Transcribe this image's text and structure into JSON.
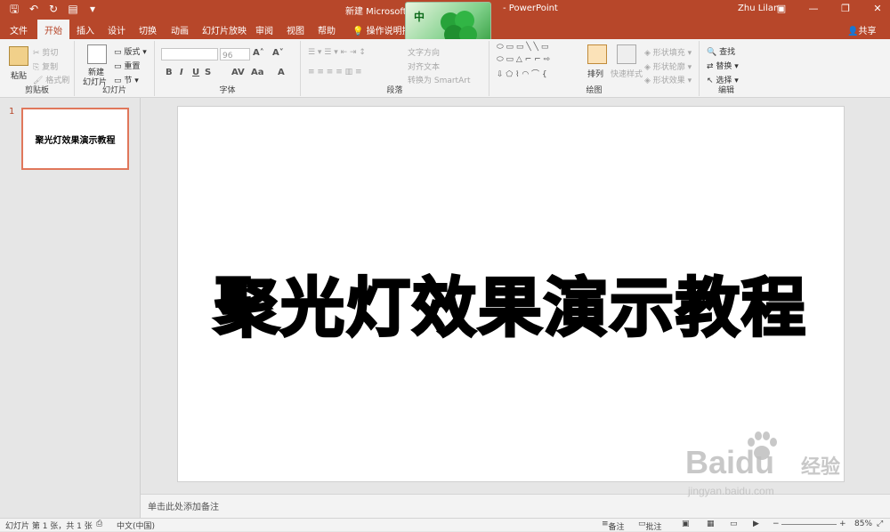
{
  "titlebar": {
    "title": "新建 Microsoft P",
    "title_suffix": "- PowerPoint",
    "user": "Zhu Lilan",
    "ime_char": "中"
  },
  "tabs": [
    "文件",
    "开始",
    "插入",
    "设计",
    "切换",
    "动画",
    "幻灯片放映",
    "审阅",
    "视图",
    "帮助"
  ],
  "active_tab": "开始",
  "tellme": "操作说明搜索",
  "share": "共享",
  "ribbon": {
    "clipboard": {
      "paste": "粘贴",
      "cut": "剪切",
      "copy": "复制",
      "painter": "格式刷",
      "label": "剪贴板"
    },
    "slides": {
      "new": "新建",
      "new2": "幻灯片",
      "layout": "版式",
      "reset": "重置",
      "section": "节",
      "label": "幻灯片"
    },
    "font": {
      "size": "96",
      "label": "字体",
      "bold": "B",
      "italic": "I",
      "underline": "U",
      "shadow": "S",
      "spacing": "AV",
      "case": "Aa",
      "color": "A"
    },
    "paragraph": {
      "textdir": "文字方向",
      "align": "对齐文本",
      "smartart": "转换为 SmartArt",
      "label": "段落"
    },
    "drawing": {
      "arrange": "排列",
      "quickstyle": "快速样式",
      "fill": "形状填充",
      "outline": "形状轮廓",
      "effect": "形状效果",
      "label": "绘图"
    },
    "editing": {
      "find": "查找",
      "replace": "替换",
      "select": "选择",
      "label": "编辑"
    }
  },
  "slide_panel": {
    "number": "1",
    "thumb_text": "聚光灯效果演示教程"
  },
  "slide": {
    "title_text": "聚光灯效果演示教程"
  },
  "notes": "单击此处添加备注",
  "status": {
    "slide_info": "幻灯片 第 1 张，共 1 张",
    "lang": "中文(中国)",
    "notes_btn": "备注",
    "comments_btn": "批注",
    "zoom": "85%"
  },
  "watermark": {
    "brand": "Baidu",
    "jy": "经验",
    "url": "jingyan.baidu.com"
  },
  "colors": {
    "accent": "#b7472a",
    "thumb_border": "#e0775b"
  }
}
